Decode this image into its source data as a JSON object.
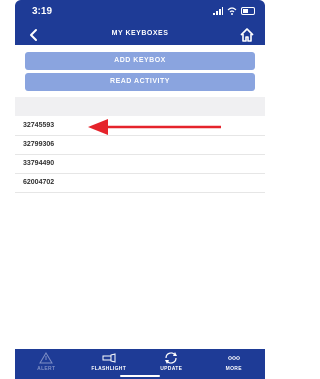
{
  "status_bar": {
    "time": "3:19"
  },
  "nav": {
    "title": "MY KEYBOXES"
  },
  "actions": {
    "add_label": "ADD KEYBOX",
    "read_label": "READ ACTIVITY"
  },
  "keyboxes": [
    "32745593",
    "32799306",
    "33794490",
    "62004702"
  ],
  "annotation": {
    "arrow_color": "#e5232b"
  },
  "tabs": [
    {
      "label": "ALERT",
      "icon": "alert-triangle-icon"
    },
    {
      "label": "FLASHLIGHT",
      "icon": "flashlight-icon"
    },
    {
      "label": "UPDATE",
      "icon": "update-icon"
    },
    {
      "label": "MORE",
      "icon": "more-icon"
    }
  ],
  "colors": {
    "brand": "#1e3b96",
    "button": "#8aa4df",
    "section": "#f0f0f2"
  }
}
